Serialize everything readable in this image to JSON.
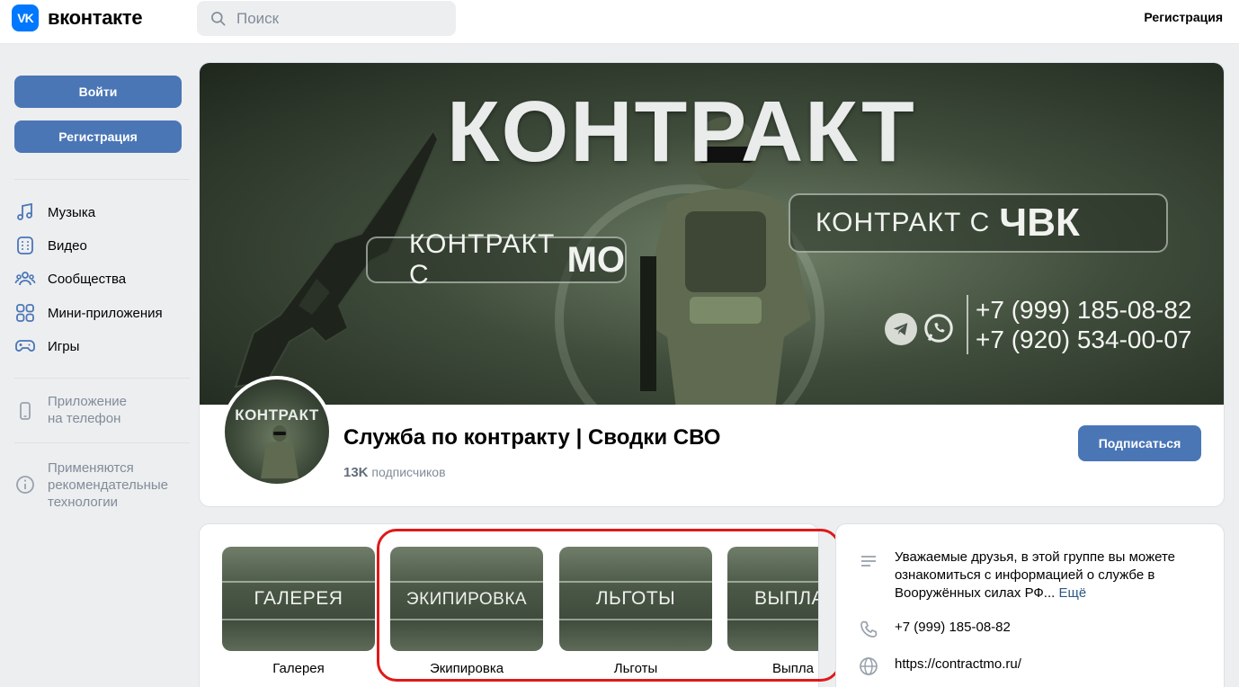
{
  "header": {
    "logo_text": "вконтакте",
    "logo_mark": "VK",
    "search_placeholder": "Поиск",
    "register_link": "Регистрация"
  },
  "sidebar": {
    "login_button": "Войти",
    "register_button": "Регистрация",
    "nav": [
      {
        "label": "Музыка",
        "icon": "music-icon"
      },
      {
        "label": "Видео",
        "icon": "video-icon"
      },
      {
        "label": "Сообщества",
        "icon": "communities-icon"
      },
      {
        "label": "Мини-приложения",
        "icon": "mini-apps-icon"
      },
      {
        "label": "Игры",
        "icon": "gamepad-icon"
      }
    ],
    "app_note": [
      "Приложение",
      "на телефон"
    ],
    "tech_note": [
      "Применяются",
      "рекомендательные",
      "технологии"
    ]
  },
  "cover": {
    "title": "КОНТРАКТ",
    "pill_left_small": "КОНТРАКТ С",
    "pill_left_big": "МО",
    "pill_right_small": "КОНТРАКТ С",
    "pill_right_big": "ЧВК",
    "phone_1": "+7 (999) 185-08-82",
    "phone_2": "+7 (920) 534-00-07"
  },
  "group": {
    "avatar_text": "КОНТРАКТ",
    "name": "Служба по контракту | Сводки СВО",
    "subscribers_count": "13K",
    "subscribers_label": "подписчиков",
    "subscribe_button": "Подписаться"
  },
  "sections": [
    {
      "tile_text": "ГАЛЕРЕЯ",
      "label": "Галерея"
    },
    {
      "tile_text": "ЭКИПИРОВКА",
      "label": "Экипировка"
    },
    {
      "tile_text": "ЛЬГОТЫ",
      "label": "Льготы"
    },
    {
      "tile_text": "ВЫПЛА",
      "label": "Выпла"
    }
  ],
  "info": {
    "description": "Уважаемые друзья, в этой группе вы можете ознакомиться с информацией о службе в Вооружённых силах РФ...",
    "more": "Ещё",
    "phone": "+7 (999) 185-08-82",
    "website": "https://contractmo.ru/"
  },
  "colors": {
    "accent": "#4a76b6",
    "vk_blue": "#0077ff",
    "highlight": "#e01919",
    "link": "#2a5885",
    "muted": "#818c99"
  }
}
